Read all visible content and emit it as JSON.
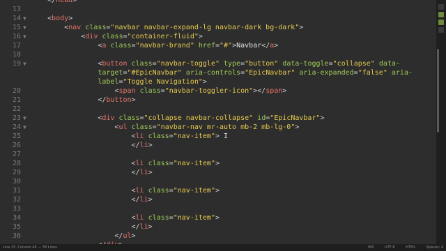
{
  "editor": {
    "lines": [
      {
        "num": "",
        "fold": false,
        "html": "<span class=\"t-punc\">    &lt;/</span><span class=\"t-tag\">head</span><span class=\"t-punc\">&gt;</span>"
      },
      {
        "num": "13",
        "fold": false,
        "html": ""
      },
      {
        "num": "14",
        "fold": true,
        "html": "<span class=\"t-punc\">    &lt;</span><span class=\"t-tag\">body</span><span class=\"t-punc\">&gt;</span>"
      },
      {
        "num": "15",
        "fold": true,
        "html": "<span class=\"t-punc\">        &lt;</span><span class=\"t-tag\">nav</span> <span class=\"t-attr\">class</span><span class=\"t-punc\">=</span><span class=\"t-str\">\"navbar navbar-expand-lg navbar-dark bg-dark\"</span><span class=\"t-punc\">&gt;</span>"
      },
      {
        "num": "16",
        "fold": true,
        "html": "<span class=\"t-punc\">            &lt;</span><span class=\"t-tag\">div</span> <span class=\"t-attr\">class</span><span class=\"t-punc\">=</span><span class=\"t-str\">\"container-fluid\"</span><span class=\"t-punc\">&gt;</span>"
      },
      {
        "num": "17",
        "fold": false,
        "html": "<span class=\"t-punc\">                &lt;</span><span class=\"t-tag\">a</span> <span class=\"t-attr\">class</span><span class=\"t-punc\">=</span><span class=\"t-str\">\"navbar-brand\"</span> <span class=\"t-attr\">href</span><span class=\"t-punc\">=</span><span class=\"t-str\">\"#\"</span><span class=\"t-punc\">&gt;</span><span class=\"t-text\">Navbar</span><span class=\"t-punc\">&lt;/</span><span class=\"t-tag\">a</span><span class=\"t-punc\">&gt;</span>"
      },
      {
        "num": "18",
        "fold": false,
        "html": ""
      },
      {
        "num": "19",
        "fold": true,
        "html": "<span class=\"t-punc\">                &lt;</span><span class=\"t-tag\">button</span> <span class=\"t-attr\">class</span><span class=\"t-punc\">=</span><span class=\"t-str\">\"navbar-toggle\"</span> <span class=\"t-attr\">type</span><span class=\"t-punc\">=</span><span class=\"t-str\">\"button\"</span> <span class=\"t-attr\">data-toggle</span><span class=\"t-punc\">=</span><span class=\"t-str\">\"collapse\"</span> <span class=\"t-attr\">data-</span>"
      },
      {
        "num": "",
        "fold": false,
        "html": "<span class=\"t-attr\">                target</span><span class=\"t-punc\">=</span><span class=\"t-str\">\"#EpicNavbar\"</span> <span class=\"t-attr\">aria-controls</span><span class=\"t-punc\">=</span><span class=\"t-str\">\"EpicNavbar\"</span> <span class=\"t-attr\">aria-expanded</span><span class=\"t-punc\">=</span><span class=\"t-str\">\"false\"</span> <span class=\"t-attr\">aria-</span>"
      },
      {
        "num": "",
        "fold": false,
        "html": "<span class=\"t-attr\">                label</span><span class=\"t-punc\">=</span><span class=\"t-str\">\"Toggle Navigation\"</span><span class=\"t-punc\">&gt;</span>"
      },
      {
        "num": "20",
        "fold": false,
        "html": "<span class=\"t-punc\">                    &lt;</span><span class=\"t-tag\">span</span> <span class=\"t-attr\">class</span><span class=\"t-punc\">=</span><span class=\"t-str\">\"navbar-toggler-icon\"</span><span class=\"t-punc\">&gt;&lt;/</span><span class=\"t-tag\">span</span><span class=\"t-punc\">&gt;</span>"
      },
      {
        "num": "21",
        "fold": false,
        "html": "<span class=\"t-punc\">                &lt;/</span><span class=\"t-tag\">button</span><span class=\"t-punc\">&gt;</span>"
      },
      {
        "num": "22",
        "fold": false,
        "html": ""
      },
      {
        "num": "23",
        "fold": true,
        "html": "<span class=\"t-punc\">                &lt;</span><span class=\"t-tag\">div</span> <span class=\"t-attr\">class</span><span class=\"t-punc\">=</span><span class=\"t-str\">\"collapse navbar-collapse\"</span> <span class=\"t-attr\">id</span><span class=\"t-punc\">=</span><span class=\"t-str\">\"EpicNavbar\"</span><span class=\"t-punc\">&gt;</span>"
      },
      {
        "num": "24",
        "fold": true,
        "html": "<span class=\"t-punc\">                    &lt;</span><span class=\"t-tag\">ul</span> <span class=\"t-attr\">class</span><span class=\"t-punc\">=</span><span class=\"t-str\">\"navbar-nav mr-auto mb-2 mb-lg-0\"</span><span class=\"t-punc\">&gt;</span>"
      },
      {
        "num": "25",
        "fold": false,
        "html": "<span class=\"t-punc\">                        &lt;</span><span class=\"t-tag\">li</span> <span class=\"t-attr\">class</span><span class=\"t-punc\">=</span><span class=\"t-str\">\"nav-item\"</span><span class=\"t-punc\">&gt;</span> <span class=\"cursor\">I</span>"
      },
      {
        "num": "26",
        "fold": false,
        "html": "<span class=\"t-punc\">                        &lt;/</span><span class=\"t-tag\">li</span><span class=\"t-punc\">&gt;</span>"
      },
      {
        "num": "27",
        "fold": false,
        "html": ""
      },
      {
        "num": "28",
        "fold": false,
        "html": "<span class=\"t-punc\">                        &lt;</span><span class=\"t-tag\">li</span> <span class=\"t-attr\">class</span><span class=\"t-punc\">=</span><span class=\"t-str\">\"nav-item\"</span><span class=\"t-punc\">&gt;</span>"
      },
      {
        "num": "29",
        "fold": false,
        "html": "<span class=\"t-punc\">                        &lt;/</span><span class=\"t-tag\">li</span><span class=\"t-punc\">&gt;</span>"
      },
      {
        "num": "30",
        "fold": false,
        "html": ""
      },
      {
        "num": "31",
        "fold": false,
        "html": "<span class=\"t-punc\">                        &lt;</span><span class=\"t-tag\">li</span> <span class=\"t-attr\">class</span><span class=\"t-punc\">=</span><span class=\"t-str\">\"nav-item\"</span><span class=\"t-punc\">&gt;</span>"
      },
      {
        "num": "32",
        "fold": false,
        "html": "<span class=\"t-punc\">                        &lt;/</span><span class=\"t-tag\">li</span><span class=\"t-punc\">&gt;</span>"
      },
      {
        "num": "33",
        "fold": false,
        "html": ""
      },
      {
        "num": "34",
        "fold": false,
        "html": "<span class=\"t-punc\">                        &lt;</span><span class=\"t-tag\">li</span> <span class=\"t-attr\">class</span><span class=\"t-punc\">=</span><span class=\"t-str\">\"nav-item\"</span><span class=\"t-punc\">&gt;</span>"
      },
      {
        "num": "35",
        "fold": false,
        "html": "<span class=\"t-punc\">                        &lt;/</span><span class=\"t-tag\">li</span><span class=\"t-punc\">&gt;</span>"
      },
      {
        "num": "36",
        "fold": false,
        "html": "<span class=\"t-punc\">                    &lt;/</span><span class=\"t-tag\">ul</span><span class=\"t-punc\">&gt;</span>"
      },
      {
        "num": "",
        "fold": false,
        "html": "<span class=\"t-punc\">                &lt;/</span><span class=\"t-tag\">div</span><span class=\"t-punc\">&gt;</span>"
      }
    ]
  },
  "statusbar": {
    "position": "Line 25, Column 46 — 58 Lines",
    "items": [
      "INS",
      "UTF-8",
      "HTML",
      "Spaces: 4"
    ]
  },
  "sidebar_icons": [
    {
      "name": "window-icon",
      "color": "#3a3a3a"
    },
    {
      "name": "git-icon",
      "color": "#6e8b3d"
    },
    {
      "name": "extension-icon",
      "color": "#6e8b3d"
    },
    {
      "name": "terminal-icon",
      "color": "#3a3a3a"
    }
  ]
}
